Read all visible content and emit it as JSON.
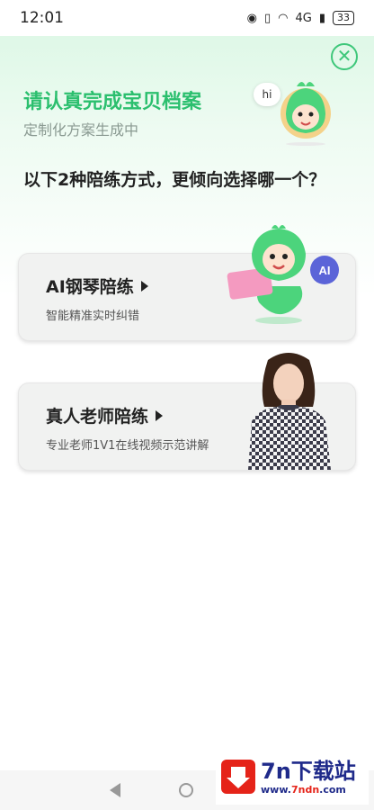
{
  "status_bar": {
    "time": "12:01",
    "network": "4G",
    "battery": "33"
  },
  "header": {
    "title": "请认真完成宝贝档案",
    "subtitle": "定制化方案生成中",
    "greeting": "hi",
    "question": "以下2种陪练方式，更倾向选择哪一个？"
  },
  "options": [
    {
      "title": "AI钢琴陪练",
      "description": "智能精准实时纠错",
      "badge": "AI"
    },
    {
      "title": "真人老师陪练",
      "description": "专业老师1V1在线视频示范讲解"
    }
  ],
  "watermark": {
    "name": "7n下载站",
    "url_prefix": "www.",
    "url_brand": "7ndn",
    "url_suffix": ".com"
  },
  "colors": {
    "accent": "#2bbf6e",
    "watermark_red": "#e52319",
    "watermark_blue": "#1f2a8a"
  }
}
